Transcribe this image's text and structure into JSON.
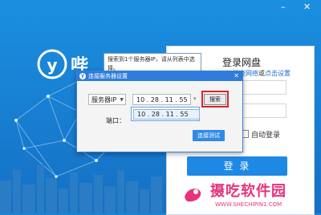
{
  "app": {
    "brand_partial": "哔"
  },
  "window": {
    "minimize_label": "–",
    "close_label": "✕"
  },
  "login": {
    "title": "登录网盘",
    "net_link_a": "检查网络",
    "net_or": "或",
    "net_link_b": "点击设置",
    "auto_login": "自动登录",
    "login_button": "登 录"
  },
  "tooltip": {
    "text": "搜索到1个服务器IP，请从列表中选择。"
  },
  "dialog": {
    "title": "连接服务器设置",
    "close": "✕",
    "server_type": "服务器IP",
    "ip_value": "10 . 28 . 11 . 55",
    "search_button": "搜索",
    "dropdown_option": "10 . 28 . 11 . 55",
    "port_label": "端口：",
    "test_button": "连接测试"
  },
  "watermark": {
    "text": "摄吃软件园",
    "url": "WWW.SHECHIPIN1.COM"
  },
  "colors": {
    "bg": "#1a86d6",
    "accent": "#2e7cdb",
    "highlight": "#d6262b",
    "watermark": "#e8327e"
  }
}
